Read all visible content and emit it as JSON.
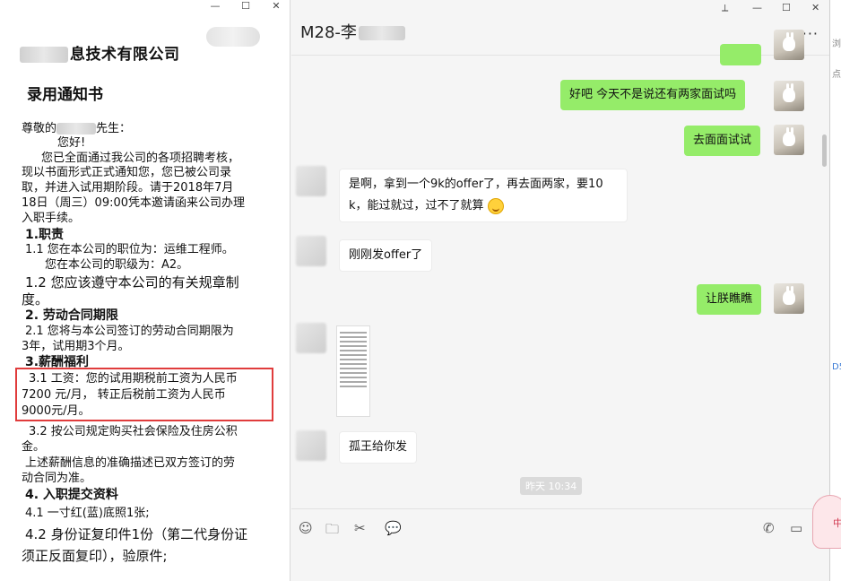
{
  "doc": {
    "company_suffix": "息技术有限公司",
    "title": "录用通知书",
    "greeting_prefix": "尊敬的",
    "greeting_suffix": "先生：",
    "hello": "您好!",
    "lines": [
      "您已全面通过我公司的各项招聘考核，",
      "现以书面形式正式通知您，您已被公司录",
      "取，并进入试用期阶段。请于2018年7月",
      "18日（周三）09:00凭本邀请函来公司办理",
      "入职手续。"
    ],
    "section1": "1.职责",
    "s1_1": "1.1  您在本公司的职位为：运维工程师。",
    "s1_1b": "您在本公司的职级为：A2。",
    "s1_2a": "1.2  您应该遵守本公司的有关规章制",
    "s1_2b": "度。",
    "section2": "2. 劳动合同期限",
    "s2_1a": "2.1  您将与本公司签订的劳动合同期限为",
    "s2_1b": "3年，试用期3个月。",
    "section3": "3.薪酬福利",
    "s3_1a": "3.1 工资：您的试用期税前工资为人民币",
    "s3_1b": "7200 元/月， 转正后税前工资为人民币",
    "s3_1c": "9000元/月。",
    "s3_2a": "3.2 按公司规定购买社会保险及住房公积",
    "s3_2b": "金。",
    "s3_3a": "上述薪酬信息的准确描述已双方签订的劳",
    "s3_3b": "动合同为准。",
    "section4": "4. 入职提交资料",
    "s4_1": "4.1 一寸红(蓝)底照1张;",
    "s4_2a": "4.2 身份证复印件1份（第二代身份证",
    "s4_2b": "须正反面复印），验原件;"
  },
  "doc_window": {
    "minimize": "—",
    "maximize": "☐",
    "close": "✕"
  },
  "chat": {
    "title_prefix": "M28-李",
    "more": "···",
    "controls": {
      "pin": "⟂",
      "minimize": "—",
      "maximize": "☐",
      "close": "✕"
    },
    "messages": [
      {
        "from": "me",
        "text": "好吧   今天不是说还有两家面试吗"
      },
      {
        "from": "me",
        "text": "去面面试试"
      },
      {
        "from": "other",
        "line1": "是啊，拿到一个9k的offer了，再去面两家，要10",
        "line2": "k，能过就过，过不了就算"
      },
      {
        "from": "other",
        "text": "刚刚发offer了"
      },
      {
        "from": "me",
        "text": "让朕瞧瞧"
      },
      {
        "from": "other",
        "type": "image"
      },
      {
        "from": "other",
        "text": "孤王给你发"
      }
    ],
    "time_label": "昨天 10:34",
    "toolbar": {
      "emoji_icon": "☺",
      "folder_icon": "🗀",
      "scissors_icon": "✂",
      "chat_icon": "💬",
      "phone_icon": "✆",
      "video_icon": "▭"
    }
  },
  "edge": {
    "text1": "浏",
    "text2": "点",
    "text3": "D5",
    "mascot": "中"
  }
}
